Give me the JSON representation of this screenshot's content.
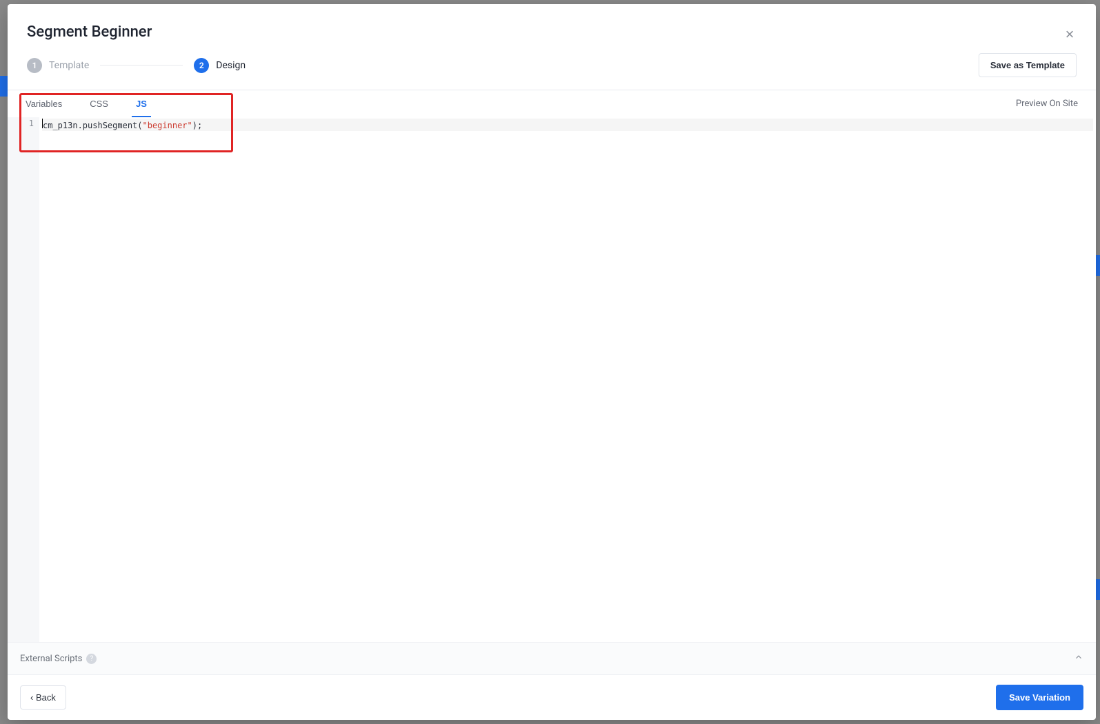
{
  "title": "Segment Beginner",
  "steps": [
    {
      "num": "1",
      "label": "Template",
      "active": false
    },
    {
      "num": "2",
      "label": "Design",
      "active": true
    }
  ],
  "buttons": {
    "save_template": "Save as Template",
    "back": "‹  Back",
    "save_variation": "Save Variation"
  },
  "tabs": {
    "variables": "Variables",
    "css": "CSS",
    "js": "JS",
    "active": "js"
  },
  "preview_link": "Preview On Site",
  "editor": {
    "line_number": "1",
    "code_prefix": "cm_p13n.pushSegment(",
    "code_string": "\"beginner\"",
    "code_suffix": ");"
  },
  "external_scripts_label": "External Scripts"
}
